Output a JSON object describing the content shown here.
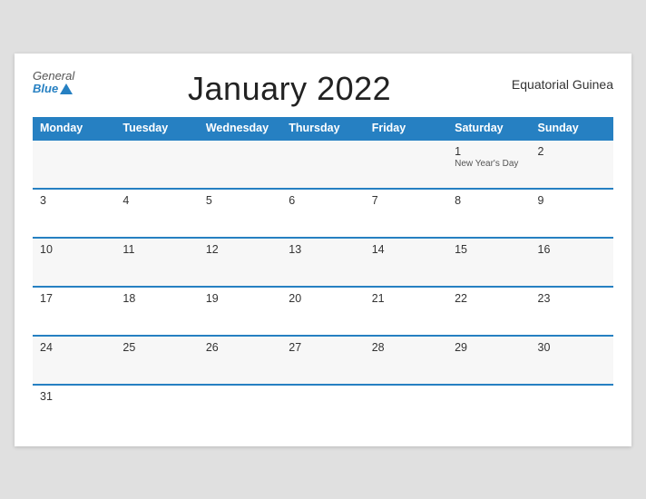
{
  "header": {
    "logo_general": "General",
    "logo_blue": "Blue",
    "title": "January 2022",
    "country": "Equatorial Guinea"
  },
  "weekdays": [
    "Monday",
    "Tuesday",
    "Wednesday",
    "Thursday",
    "Friday",
    "Saturday",
    "Sunday"
  ],
  "weeks": [
    [
      {
        "day": "",
        "holiday": ""
      },
      {
        "day": "",
        "holiday": ""
      },
      {
        "day": "",
        "holiday": ""
      },
      {
        "day": "",
        "holiday": ""
      },
      {
        "day": "",
        "holiday": ""
      },
      {
        "day": "1",
        "holiday": "New Year's Day"
      },
      {
        "day": "2",
        "holiday": ""
      }
    ],
    [
      {
        "day": "3",
        "holiday": ""
      },
      {
        "day": "4",
        "holiday": ""
      },
      {
        "day": "5",
        "holiday": ""
      },
      {
        "day": "6",
        "holiday": ""
      },
      {
        "day": "7",
        "holiday": ""
      },
      {
        "day": "8",
        "holiday": ""
      },
      {
        "day": "9",
        "holiday": ""
      }
    ],
    [
      {
        "day": "10",
        "holiday": ""
      },
      {
        "day": "11",
        "holiday": ""
      },
      {
        "day": "12",
        "holiday": ""
      },
      {
        "day": "13",
        "holiday": ""
      },
      {
        "day": "14",
        "holiday": ""
      },
      {
        "day": "15",
        "holiday": ""
      },
      {
        "day": "16",
        "holiday": ""
      }
    ],
    [
      {
        "day": "17",
        "holiday": ""
      },
      {
        "day": "18",
        "holiday": ""
      },
      {
        "day": "19",
        "holiday": ""
      },
      {
        "day": "20",
        "holiday": ""
      },
      {
        "day": "21",
        "holiday": ""
      },
      {
        "day": "22",
        "holiday": ""
      },
      {
        "day": "23",
        "holiday": ""
      }
    ],
    [
      {
        "day": "24",
        "holiday": ""
      },
      {
        "day": "25",
        "holiday": ""
      },
      {
        "day": "26",
        "holiday": ""
      },
      {
        "day": "27",
        "holiday": ""
      },
      {
        "day": "28",
        "holiday": ""
      },
      {
        "day": "29",
        "holiday": ""
      },
      {
        "day": "30",
        "holiday": ""
      }
    ],
    [
      {
        "day": "31",
        "holiday": ""
      },
      {
        "day": "",
        "holiday": ""
      },
      {
        "day": "",
        "holiday": ""
      },
      {
        "day": "",
        "holiday": ""
      },
      {
        "day": "",
        "holiday": ""
      },
      {
        "day": "",
        "holiday": ""
      },
      {
        "day": "",
        "holiday": ""
      }
    ]
  ]
}
